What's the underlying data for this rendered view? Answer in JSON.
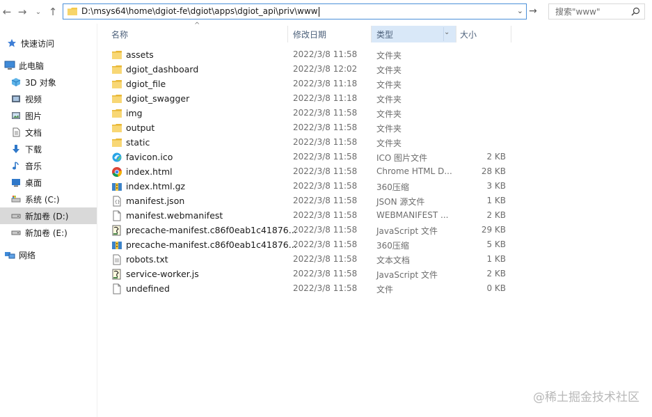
{
  "address": {
    "path": "D:\\msys64\\home\\dgiot-fe\\dgiot\\apps\\dgiot_api\\priv\\www"
  },
  "search": {
    "placeholder": "搜索\"www\""
  },
  "sidebar": {
    "items": [
      {
        "label": "快速访问",
        "icon": "star-icon"
      },
      {
        "label": "此电脑",
        "icon": "computer-icon"
      },
      {
        "label": "3D 对象",
        "icon": "cube-icon"
      },
      {
        "label": "视频",
        "icon": "video-icon"
      },
      {
        "label": "图片",
        "icon": "picture-icon"
      },
      {
        "label": "文档",
        "icon": "document-icon"
      },
      {
        "label": "下载",
        "icon": "download-icon"
      },
      {
        "label": "音乐",
        "icon": "music-icon"
      },
      {
        "label": "桌面",
        "icon": "desktop-icon"
      },
      {
        "label": "系统 (C:)",
        "icon": "system-drive-icon"
      },
      {
        "label": "新加卷 (D:)",
        "icon": "drive-icon",
        "selected": true
      },
      {
        "label": "新加卷 (E:)",
        "icon": "drive-icon"
      },
      {
        "label": "网络",
        "icon": "network-icon"
      }
    ]
  },
  "columns": {
    "name": "名称",
    "date": "修改日期",
    "type": "类型",
    "size": "大小"
  },
  "files": [
    {
      "name": "assets",
      "date": "2022/3/8 11:58",
      "type": "文件夹",
      "size": "",
      "icon": "folder-icon"
    },
    {
      "name": "dgiot_dashboard",
      "date": "2022/3/8 12:02",
      "type": "文件夹",
      "size": "",
      "icon": "folder-icon"
    },
    {
      "name": "dgiot_file",
      "date": "2022/3/8 11:18",
      "type": "文件夹",
      "size": "",
      "icon": "folder-icon"
    },
    {
      "name": "dgiot_swagger",
      "date": "2022/3/8 11:18",
      "type": "文件夹",
      "size": "",
      "icon": "folder-icon"
    },
    {
      "name": "img",
      "date": "2022/3/8 11:58",
      "type": "文件夹",
      "size": "",
      "icon": "folder-icon"
    },
    {
      "name": "output",
      "date": "2022/3/8 11:58",
      "type": "文件夹",
      "size": "",
      "icon": "folder-icon"
    },
    {
      "name": "static",
      "date": "2022/3/8 11:58",
      "type": "文件夹",
      "size": "",
      "icon": "folder-icon"
    },
    {
      "name": "favicon.ico",
      "date": "2022/3/8 11:58",
      "type": "ICO 图片文件",
      "size": "2 KB",
      "icon": "ico-file-icon"
    },
    {
      "name": "index.html",
      "date": "2022/3/8 11:58",
      "type": "Chrome HTML D...",
      "size": "28 KB",
      "icon": "chrome-icon"
    },
    {
      "name": "index.html.gz",
      "date": "2022/3/8 11:58",
      "type": "360压缩",
      "size": "3 KB",
      "icon": "archive-icon"
    },
    {
      "name": "manifest.json",
      "date": "2022/3/8 11:58",
      "type": "JSON 源文件",
      "size": "1 KB",
      "icon": "json-file-icon"
    },
    {
      "name": "manifest.webmanifest",
      "date": "2022/3/8 11:58",
      "type": "WEBMANIFEST ...",
      "size": "2 KB",
      "icon": "blank-file-icon"
    },
    {
      "name": "precache-manifest.c86f0eab1c41876...",
      "date": "2022/3/8 11:58",
      "type": "JavaScript 文件",
      "size": "29 KB",
      "icon": "script-file-icon"
    },
    {
      "name": "precache-manifest.c86f0eab1c41876...",
      "date": "2022/3/8 11:58",
      "type": "360压缩",
      "size": "5 KB",
      "icon": "archive-icon"
    },
    {
      "name": "robots.txt",
      "date": "2022/3/8 11:58",
      "type": "文本文档",
      "size": "1 KB",
      "icon": "text-file-icon"
    },
    {
      "name": "service-worker.js",
      "date": "2022/3/8 11:58",
      "type": "JavaScript 文件",
      "size": "2 KB",
      "icon": "script-file-icon"
    },
    {
      "name": "undefined",
      "date": "2022/3/8 11:58",
      "type": "文件",
      "size": "0 KB",
      "icon": "blank-file-icon"
    }
  ],
  "watermark": "@稀土掘金技术社区",
  "colors": {
    "selected": "#d9d9d9",
    "active_header": "#d9e8f8",
    "address_border": "#4a8fd9",
    "folder": "#f4c94a"
  }
}
